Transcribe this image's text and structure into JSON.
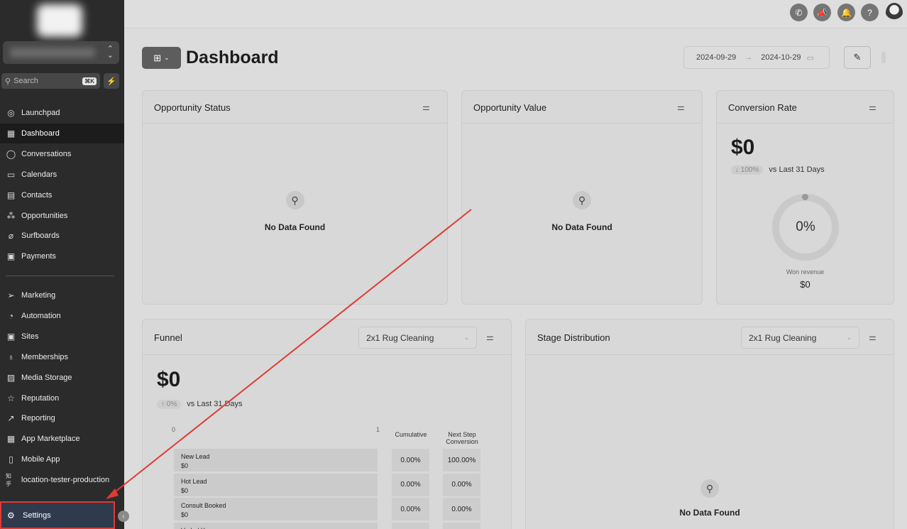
{
  "sidebar": {
    "search_placeholder": "Search",
    "search_shortcut": "⌘K",
    "items_top": [
      {
        "label": "Launchpad",
        "icon": "rocket-icon",
        "glyph": "◎"
      },
      {
        "label": "Dashboard",
        "icon": "grid-icon",
        "glyph": "▦"
      },
      {
        "label": "Conversations",
        "icon": "chat-icon",
        "glyph": "◯"
      },
      {
        "label": "Calendars",
        "icon": "calendar-icon",
        "glyph": "▭"
      },
      {
        "label": "Contacts",
        "icon": "contacts-icon",
        "glyph": "▤"
      },
      {
        "label": "Opportunities",
        "icon": "opportunities-icon",
        "glyph": "⁂"
      },
      {
        "label": "Surfboards",
        "icon": "surfboard-icon",
        "glyph": "⌀"
      },
      {
        "label": "Payments",
        "icon": "payments-icon",
        "glyph": "▣"
      }
    ],
    "items_bottom": [
      {
        "label": "Marketing",
        "icon": "send-icon",
        "glyph": "➢"
      },
      {
        "label": "Automation",
        "icon": "automation-icon",
        "glyph": "◔"
      },
      {
        "label": "Sites",
        "icon": "sites-icon",
        "glyph": "▣"
      },
      {
        "label": "Memberships",
        "icon": "award-icon",
        "glyph": "♁"
      },
      {
        "label": "Media Storage",
        "icon": "image-icon",
        "glyph": "▨"
      },
      {
        "label": "Reputation",
        "icon": "star-icon",
        "glyph": "☆"
      },
      {
        "label": "Reporting",
        "icon": "trend-icon",
        "glyph": "↗"
      },
      {
        "label": "App Marketplace",
        "icon": "apps-icon",
        "glyph": "▦"
      },
      {
        "label": "Mobile App",
        "icon": "mobile-icon",
        "glyph": "▯"
      },
      {
        "label": "location-tester-production",
        "icon": "location-tag-icon",
        "glyph": "知乎"
      }
    ],
    "settings_label": "Settings"
  },
  "header": {
    "title": "Dashboard",
    "date_start": "2024-09-29",
    "date_end": "2024-10-29",
    "date_arrow": "→"
  },
  "cards": {
    "opportunity_status": {
      "title": "Opportunity Status",
      "empty": "No Data Found"
    },
    "opportunity_value": {
      "title": "Opportunity Value",
      "empty": "No Data Found"
    },
    "conversion_rate": {
      "title": "Conversion Rate",
      "value": "$0",
      "change": "↓ 100%",
      "compare": "vs Last 31 Days",
      "donut_value": "0%",
      "won_label": "Won revenue",
      "won_value": "$0"
    },
    "funnel": {
      "title": "Funnel",
      "pipeline": "2x1 Rug Cleaning",
      "value": "$0",
      "change": "↑ 0%",
      "compare": "vs Last 31 Days",
      "axis_min": "0",
      "axis_max": "1",
      "col_cumulative": "Cumulative",
      "col_next_step": "Next Step Conversion",
      "rows": [
        {
          "stage": "New Lead",
          "amount": "$0",
          "cumulative": "0.00%",
          "next": "100.00%"
        },
        {
          "stage": "Hot Lead",
          "amount": "$0",
          "cumulative": "0.00%",
          "next": "0.00%"
        },
        {
          "stage": "Consult Booked",
          "amount": "$0",
          "cumulative": "0.00%",
          "next": "0.00%"
        },
        {
          "stage": "Verbal Yes",
          "amount": "",
          "cumulative": "",
          "next": ""
        }
      ]
    },
    "stage_distribution": {
      "title": "Stage Distribution",
      "pipeline": "2x1 Rug Cleaning",
      "empty": "No Data Found"
    }
  },
  "colors": {
    "annotation": "#e03b35",
    "sidebar_bg": "#2b2b2b",
    "page_bg": "#dcdcdc"
  }
}
